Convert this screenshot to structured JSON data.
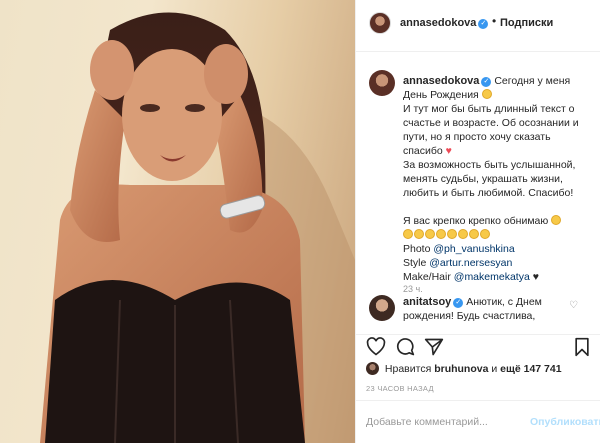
{
  "post": {
    "photo_description_icon": "portrait-photo"
  },
  "header": {
    "username": "annasedokova",
    "verified_mark": "✓",
    "separator": "•",
    "follow_label": "Подписки"
  },
  "caption": {
    "username": "annasedokova",
    "verified_mark": "✓",
    "lines": [
      "Сегодня у меня",
      "День Рождения",
      "И тут мог бы быть длинный текст о",
      "счастье и возрасте. Об осознании и",
      "пути, но я просто хочу сказать",
      "спасибо",
      "За возможность быть услышанной,",
      "менять судьбы, украшать жизни,",
      "любить и быть любимой. Спасибо!",
      "",
      "Я вас крепко крепко обнимаю"
    ],
    "credit_photo_label": "Photo",
    "credit_photo_handle": "@ph_vanushkina",
    "credit_style_label": "Style",
    "credit_style_handle": "@artur.nersesyan",
    "credit_mua_label": "Make/Hair",
    "credit_mua_handle": "@makemekatya",
    "heart": "♥",
    "black_heart": "♥",
    "time": "23 ч."
  },
  "reply": {
    "username": "anitatsoy",
    "verified_mark": "✓",
    "text_line1": "Анютик, с Днем",
    "text_line2": "рождения! Будь счастлива,",
    "heart": "♡"
  },
  "likes": {
    "prefix": "Нравится",
    "user": "bruhunova",
    "conjunction": "и",
    "count_text": "ещё 147 741"
  },
  "posted_ago": "23 ЧАСОВ НАЗАД",
  "comment_box": {
    "placeholder": "Добавьте комментарий...",
    "publish_label": "Опубликовать"
  },
  "colors": {
    "link": "#003569",
    "verified": "#3897f0",
    "publish_disabled": "#b2dffc",
    "heart": "#ed4956"
  }
}
